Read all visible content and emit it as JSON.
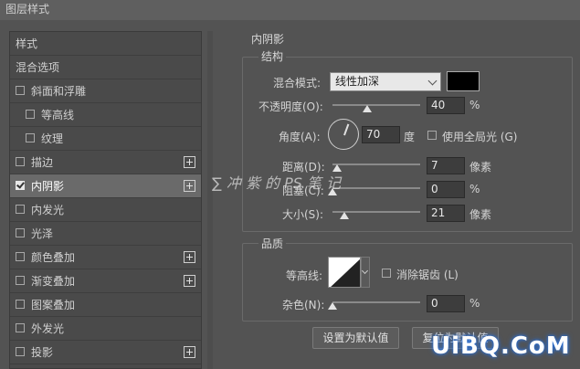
{
  "window": {
    "title": "图层样式"
  },
  "left_panel": {
    "items": [
      {
        "label": "样式",
        "type": "header"
      },
      {
        "label": "混合选项",
        "type": "header"
      },
      {
        "label": "斜面和浮雕",
        "checked": false,
        "indent": 0,
        "plus": false
      },
      {
        "label": "等高线",
        "checked": false,
        "indent": 1,
        "plus": false
      },
      {
        "label": "纹理",
        "checked": false,
        "indent": 1,
        "plus": false
      },
      {
        "label": "描边",
        "checked": false,
        "indent": 0,
        "plus": true
      },
      {
        "label": "内阴影",
        "checked": true,
        "indent": 0,
        "plus": true,
        "selected": true
      },
      {
        "label": "内发光",
        "checked": false,
        "indent": 0,
        "plus": false
      },
      {
        "label": "光泽",
        "checked": false,
        "indent": 0,
        "plus": false
      },
      {
        "label": "颜色叠加",
        "checked": false,
        "indent": 0,
        "plus": true
      },
      {
        "label": "渐变叠加",
        "checked": false,
        "indent": 0,
        "plus": true
      },
      {
        "label": "图案叠加",
        "checked": false,
        "indent": 0,
        "plus": false
      },
      {
        "label": "外发光",
        "checked": false,
        "indent": 0,
        "plus": false
      },
      {
        "label": "投影",
        "checked": false,
        "indent": 0,
        "plus": true
      }
    ]
  },
  "inner_shadow": {
    "title": "内阴影",
    "structure": {
      "title": "结构",
      "blend_mode_label": "混合模式:",
      "blend_mode_value": "线性加深",
      "color": "#000000",
      "opacity_label": "不透明度(O):",
      "opacity_value": "40",
      "opacity_fraction": 0.4,
      "opacity_unit": "%",
      "angle_label": "角度(A):",
      "angle_value": "70",
      "angle_unit": "度",
      "global_light_label": "使用全局光 (G)",
      "distance_label": "距离(D):",
      "distance_value": "7",
      "distance_unit": "像素",
      "choke_label": "阻塞(C):",
      "choke_value": "0",
      "choke_unit": "%",
      "size_label": "大小(S):",
      "size_value": "21",
      "size_unit": "像素"
    },
    "quality": {
      "title": "品质",
      "contour_label": "等高线:",
      "anti_alias_label": "消除锯齿 (L)",
      "noise_label": "杂色(N):",
      "noise_value": "0",
      "noise_unit": "%"
    },
    "buttons": {
      "set_default": "设置为默认值",
      "reset_default": "复位为默认值"
    }
  },
  "watermarks": {
    "overlay": "∑ 冲 紫 的 PS 笔 记",
    "site": "UiBQ.CoM"
  },
  "colors": {
    "panel_bg": "#535353",
    "selected_bg": "#6a6a6a",
    "site_glow": "#2a6fd6"
  }
}
